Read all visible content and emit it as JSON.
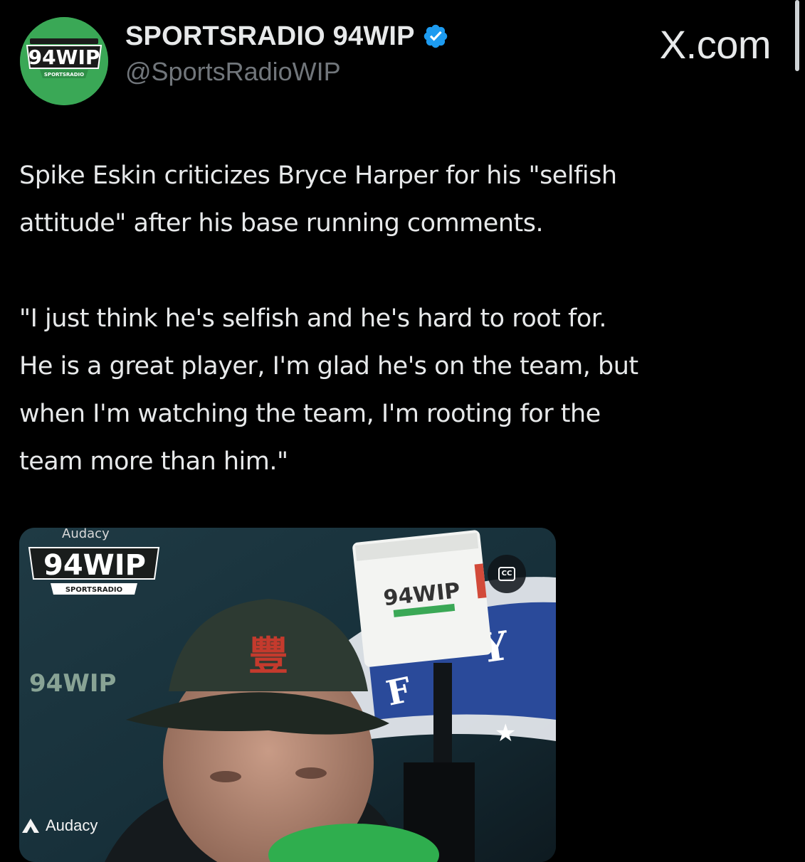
{
  "header": {
    "display_name": "SPORTSRADIO 94WIP",
    "handle": "@SportsRadioWIP",
    "brand": "X.com",
    "avatar_logo_text": "94WIP",
    "avatar_logo_subtext": "SPORTSRADIO",
    "verified_color": "#1d9bf0"
  },
  "tweet": {
    "paragraphs": [
      "Spike Eskin criticizes Bryce Harper for his \"selfish\nattitude\" after his base running comments.",
      "\"I just think he's selfish and he's hard to root for.\nHe is a great player, I'm glad he's on the team, but\nwhen I'm watching the team, I'm rooting for the\nteam more than him.\""
    ]
  },
  "media": {
    "watermark_top": "Audacy",
    "logo_text": "94WIP",
    "logo_subtext": "SPORTSRADIO",
    "mic_flag_text": "94WIP",
    "cc_label": "CC",
    "watermark_bottom": "Audacy"
  },
  "colors": {
    "background": "#000000",
    "text_primary": "#e7e9ea",
    "text_secondary": "#71767b",
    "avatar_green": "#3aa856"
  }
}
